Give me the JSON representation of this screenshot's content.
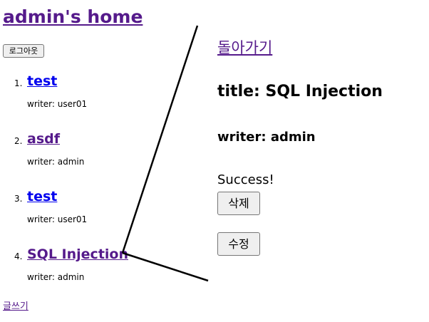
{
  "home": {
    "title": "admin's home",
    "logout_label": "로그아웃",
    "write_label": "글쓰기",
    "posts": [
      {
        "num": "1.",
        "title": "test",
        "writer": "writer: user01"
      },
      {
        "num": "2.",
        "title": "asdf",
        "writer": "writer: admin"
      },
      {
        "num": "3.",
        "title": "test",
        "writer": "writer: user01"
      },
      {
        "num": "4.",
        "title": "SQL Injection",
        "writer": "writer: admin"
      }
    ]
  },
  "detail": {
    "back_label": "돌아가기",
    "title": "title: SQL Injection",
    "writer": "writer: admin",
    "content": "Success!",
    "delete_label": "삭제",
    "edit_label": "수정"
  },
  "colors": {
    "link_unvisited": "#0000ee",
    "link_visited": "#551a8b",
    "callout_line": "#000000"
  }
}
